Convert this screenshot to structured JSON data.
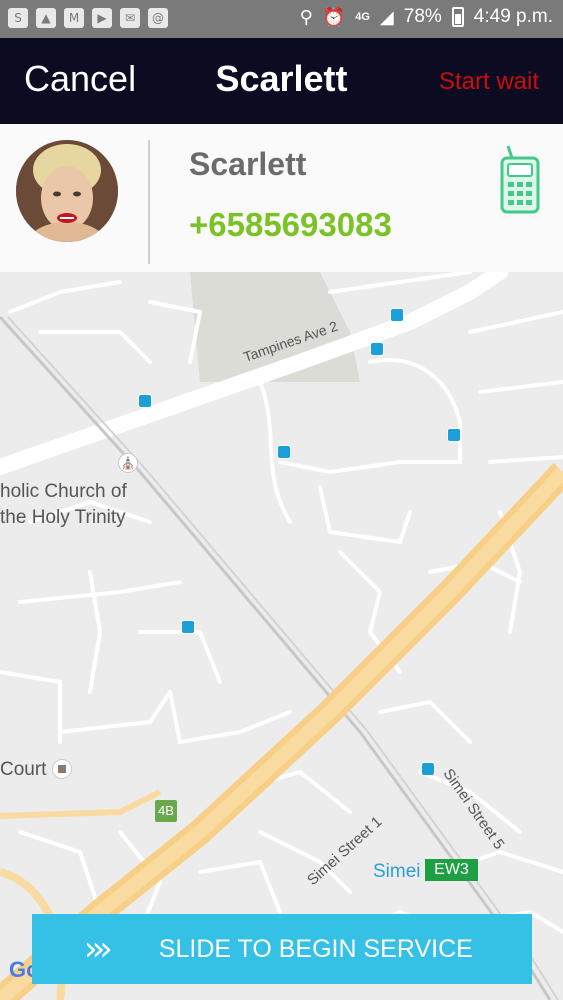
{
  "status_bar": {
    "battery": "78%",
    "time": "4:49 p.m.",
    "network": "4G"
  },
  "header": {
    "cancel_label": "Cancel",
    "title": "Scarlett",
    "start_wait_label": "Start wait"
  },
  "contact": {
    "name": "Scarlett",
    "phone": "+6585693083"
  },
  "map": {
    "labels": {
      "tampines": "Tampines Ave 2",
      "church_line1": "holic Church of",
      "church_line2": "the Holy Trinity",
      "court": "Court",
      "simei_st1": "Simei Street 1",
      "simei_st5": "Simei Street 5",
      "simei": "Simei",
      "ew3": "EW3",
      "exit": "4B",
      "google": "Goog"
    }
  },
  "slide_button": {
    "label": "SLIDE TO BEGIN SERVICE"
  },
  "colors": {
    "topbar": "#0b0b22",
    "accent_red": "#cc0d0d",
    "accent_green": "#7ac226",
    "slide": "#35c1e5"
  }
}
